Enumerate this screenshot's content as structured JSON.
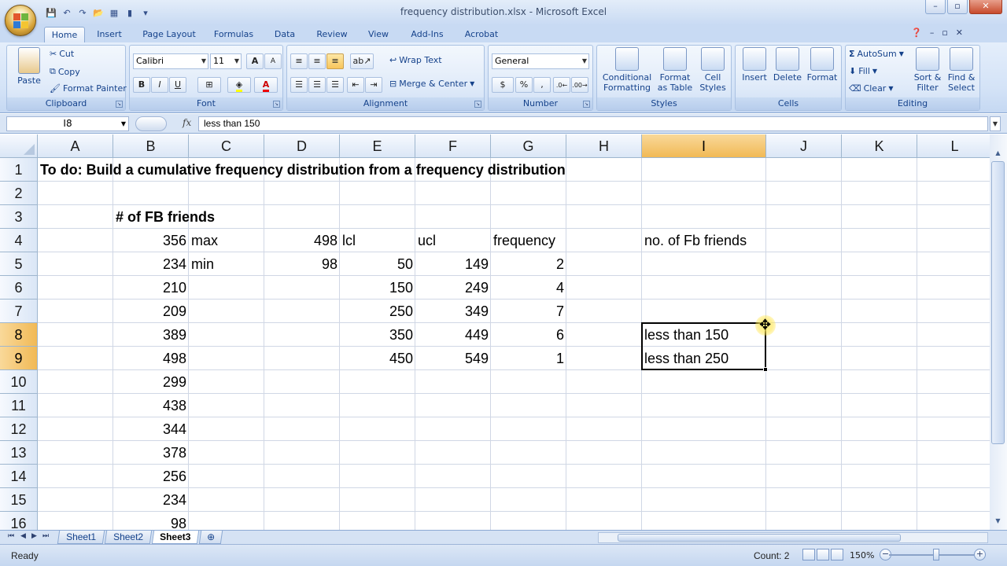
{
  "window": {
    "title": "frequency distribution.xlsx - Microsoft Excel",
    "controls": {
      "minimize": "–",
      "restore": "▫",
      "close": "✕"
    }
  },
  "quick_access": {
    "icons": [
      "save-icon",
      "undo-icon",
      "redo-icon",
      "open-icon",
      "table-icon",
      "chart-icon",
      "customize-icon"
    ]
  },
  "tabs": [
    "Home",
    "Insert",
    "Page Layout",
    "Formulas",
    "Data",
    "Review",
    "View",
    "Add-Ins",
    "Acrobat"
  ],
  "active_tab": "Home",
  "ribbon": {
    "clipboard": {
      "name": "Clipboard",
      "paste": "Paste",
      "cut": "Cut",
      "copy": "Copy",
      "format_painter": "Format Painter"
    },
    "font": {
      "name": "Font",
      "family": "Calibri",
      "size": "11",
      "bold": "B",
      "italic": "I",
      "underline": "U",
      "grow": "A",
      "shrink": "A"
    },
    "alignment": {
      "name": "Alignment",
      "wrap": "Wrap Text",
      "merge": "Merge & Center"
    },
    "number": {
      "name": "Number",
      "format": "General",
      "currency": "$",
      "percent": "%",
      "comma": ","
    },
    "styles": {
      "name": "Styles",
      "conditional": "Conditional",
      "conditional2": "Formatting",
      "format_as": "Format",
      "format_as2": "as Table",
      "cell": "Cell",
      "cell2": "Styles"
    },
    "cells": {
      "name": "Cells",
      "insert": "Insert",
      "delete": "Delete",
      "format": "Format"
    },
    "editing": {
      "name": "Editing",
      "autosum": "AutoSum",
      "fill": "Fill",
      "clear": "Clear",
      "sort": "Sort &",
      "sort2": "Filter",
      "find": "Find &",
      "find2": "Select"
    }
  },
  "formula_bar": {
    "name_box": "I8",
    "fx": "fx",
    "content": "less than 150"
  },
  "columns": [
    "A",
    "B",
    "C",
    "D",
    "E",
    "F",
    "G",
    "H",
    "I",
    "J",
    "K",
    "L"
  ],
  "selected_column": "I",
  "rows": [
    "1",
    "2",
    "3",
    "4",
    "5",
    "6",
    "7",
    "8",
    "9",
    "10",
    "11",
    "12",
    "13",
    "14",
    "15",
    "16"
  ],
  "selected_rows": [
    "8",
    "9"
  ],
  "cells": {
    "A1": "To do:  Build a cumulative frequency distribution from a frequency distribution",
    "B3": "# of FB friends",
    "B4": "356",
    "C4": "max",
    "D4": "498",
    "E4": "lcl",
    "F4": "ucl",
    "G4": "frequency",
    "I4": "no. of Fb friends",
    "B5": "234",
    "C5": "min",
    "D5": "98",
    "E5": "50",
    "F5": "149",
    "G5": "2",
    "B6": "210",
    "E6": "150",
    "F6": "249",
    "G6": "4",
    "B7": "209",
    "E7": "250",
    "F7": "349",
    "G7": "7",
    "B8": "389",
    "E8": "350",
    "F8": "449",
    "G8": "6",
    "I8": "less than 150",
    "B9": "498",
    "E9": "450",
    "F9": "549",
    "G9": "1",
    "I9": "less than 250",
    "B10": "299",
    "B11": "438",
    "B12": "344",
    "B13": "378",
    "B14": "256",
    "B15": "234",
    "B16": "98"
  },
  "sheets": [
    "Sheet1",
    "Sheet2",
    "Sheet3"
  ],
  "active_sheet": "Sheet3",
  "status": {
    "ready": "Ready",
    "count": "Count: 2",
    "zoom": "150%",
    "zoom_out": "−",
    "zoom_in": "+"
  },
  "colors": {
    "accent": "#15428b",
    "selection": "#f1b955",
    "ribbon": "#d4e3f7"
  }
}
